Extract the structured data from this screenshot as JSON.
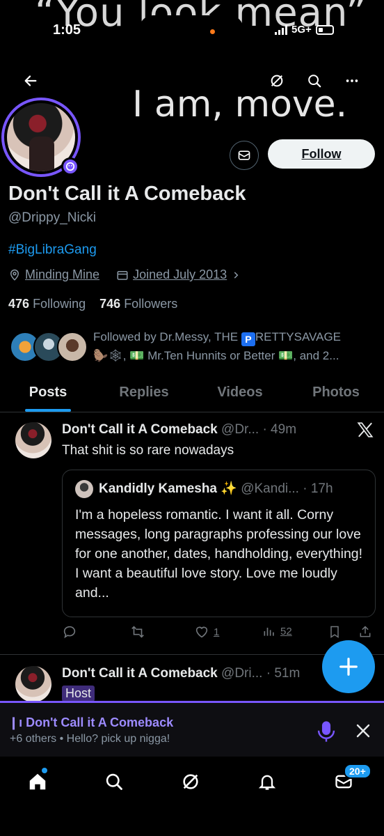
{
  "status_bar": {
    "time": "1:05",
    "network": "5G+"
  },
  "banner": {
    "top_text": "“You look mean”",
    "main_text": "I am, move."
  },
  "top_nav": {
    "back_icon": "arrow-left-icon",
    "grok_icon": "grok-icon",
    "search_icon": "search-icon",
    "more_icon": "more-icon"
  },
  "profile": {
    "display_name": "Don't Call it A Comeback",
    "handle": "@Drippy_Nicki",
    "bio": "#BigLibraGang",
    "location": "Minding Mine",
    "joined": "Joined July 2013",
    "following_count": "476",
    "following_label": "Following",
    "followers_count": "746",
    "followers_label": "Followers",
    "follow_label": "Follow",
    "followed_by_line1_a": "Followed by Dr.Messy, THE",
    "followed_by_p": "P",
    "followed_by_line1_b": "RETTYSAVAGE",
    "followed_by_line2": "🦫🕸, 💵 Mr.Ten Hunnits or Better 💵, and 2..."
  },
  "tabs": [
    "Posts",
    "Replies",
    "Videos",
    "Photos"
  ],
  "post1": {
    "author": "Don't Call it A Comeback",
    "handle_time": "@Dr... · 49m",
    "text": "That shit is so rare nowadays",
    "quote": {
      "author": "Kandidly Kamesha ✨",
      "handle_time": "@Kandi... · 17h",
      "text": "I'm a hopeless romantic. I want it all. Corny messages, long paragraphs professing our love for one another, dates, handholding, everything! I want a beautiful love story. Love me loudly and..."
    },
    "likes": "1",
    "views": "52"
  },
  "post2": {
    "author": "Don't Call it A Comeback",
    "handle_time": "@Dri... · 51m",
    "badge": "Host"
  },
  "spaces": {
    "title": "Don't Call it A Comeback",
    "subtitle": "+6 others • Hello? pick up nigga!"
  },
  "bottom_nav": {
    "messages_badge": "20+"
  },
  "colors": {
    "accent": "#1d9bf0",
    "spaces": "#7856ff",
    "background": "#000000"
  }
}
